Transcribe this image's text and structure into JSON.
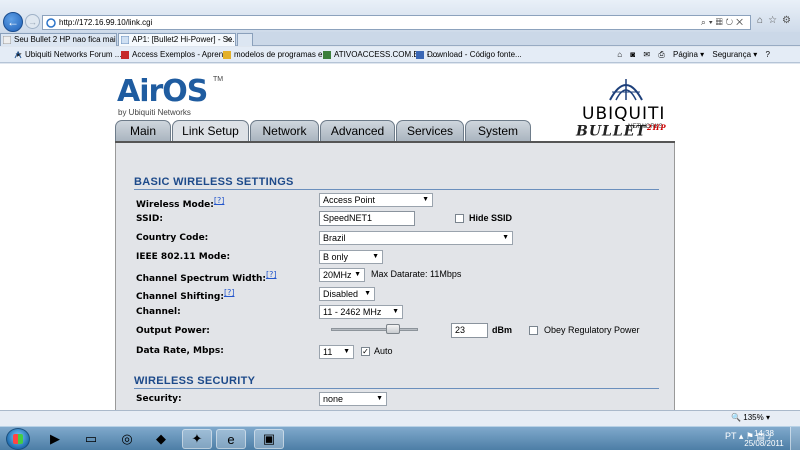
{
  "browser": {
    "url": "http://172.16.99.10/link.cgi",
    "tabs": [
      {
        "label": "Seu Bullet 2 HP nao fica mais e...",
        "active": false
      },
      {
        "label": "AP1: [Bullet2 Hi-Power] - Se...",
        "active": true
      }
    ],
    "favorites": [
      "Ubiquiti Networks Forum ...",
      "Access Exemplos - Apren...",
      "modelos de programas e...",
      "ATIVOACCESS.COM.BR - ...",
      "Download - Código fonte..."
    ],
    "commands": {
      "page": "Página ▾",
      "security": "Segurança ▾"
    },
    "zoom": "135%",
    "zoom_arrow": "▾"
  },
  "header": {
    "logo_air": "Air",
    "logo_os": "OS",
    "logo_tm": "TM",
    "logo_by": "by Ubiquiti Networks",
    "brand": "UBIQUITI",
    "brand_sub": "NETWORKS",
    "product": "BULLET",
    "product_sup": "2HP"
  },
  "nav_tabs": [
    "Main",
    "Link Setup",
    "Network",
    "Advanced",
    "Services",
    "System"
  ],
  "active_tab": "Link Setup",
  "basic": {
    "title": "BASIC WIRELESS SETTINGS",
    "wireless_mode_label": "Wireless Mode:",
    "help": "[?]",
    "wireless_mode_value": "Access Point",
    "ssid_label": "SSID:",
    "ssid_value": "SpeedNET1",
    "hide_ssid_label": "Hide SSID",
    "country_label": "Country Code:",
    "country_value": "Brazil",
    "ieee_label": "IEEE 802.11 Mode:",
    "ieee_value": "B only",
    "spectrum_label": "Channel Spectrum Width:",
    "spectrum_value": "20MHz",
    "max_datarate": "Max Datarate: 11Mbps",
    "shifting_label": "Channel Shifting:",
    "shifting_value": "Disabled",
    "channel_label": "Channel:",
    "channel_value": "11 - 2462 MHz",
    "power_label": "Output Power:",
    "power_value": "23",
    "power_unit": "dBm",
    "obey_label": "Obey Regulatory Power",
    "datarate_label": "Data Rate, Mbps:",
    "datarate_value": "11",
    "auto_label": "Auto",
    "auto_check": "✓"
  },
  "security": {
    "title": "WIRELESS SECURITY",
    "security_label": "Security:",
    "security_value": "none"
  },
  "taskbar": {
    "lang": "PT",
    "time": "14:38",
    "date": "25/08/2011"
  }
}
